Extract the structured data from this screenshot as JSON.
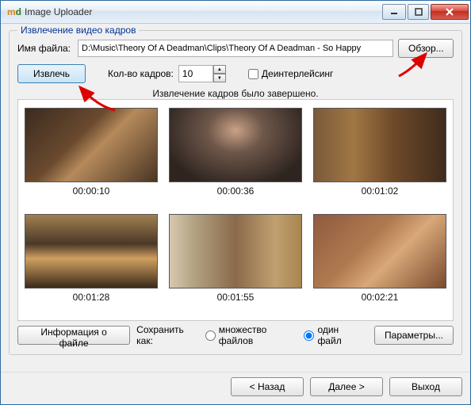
{
  "window": {
    "title": "Image Uploader",
    "logo_a": "m",
    "logo_b": "d"
  },
  "group": {
    "title": "Извлечение видео кадров",
    "filename_label": "Имя файла:",
    "filename_value": "D:\\Music\\Theory Of A Deadman\\Clips\\Theory Of A Deadman - So Happy",
    "browse_btn": "Обзор...",
    "extract_btn": "Извлечь",
    "frames_label": "Кол-во кадров:",
    "frames_value": "10",
    "deinterlace_label": "Деинтерлейсинг",
    "status": "Извлечение кадров было завершено."
  },
  "thumbs": [
    {
      "time": "00:00:10"
    },
    {
      "time": "00:00:36"
    },
    {
      "time": "00:01:02"
    },
    {
      "time": "00:01:28"
    },
    {
      "time": "00:01:55"
    },
    {
      "time": "00:02:21"
    }
  ],
  "bottom": {
    "fileinfo_btn": "Информация о файле",
    "saveas_label": "Сохранить как:",
    "radio_multi": "множество файлов",
    "radio_one": "один файл",
    "params_btn": "Параметры..."
  },
  "nav": {
    "back": "< Назад",
    "next": "Далее >",
    "exit": "Выход"
  }
}
